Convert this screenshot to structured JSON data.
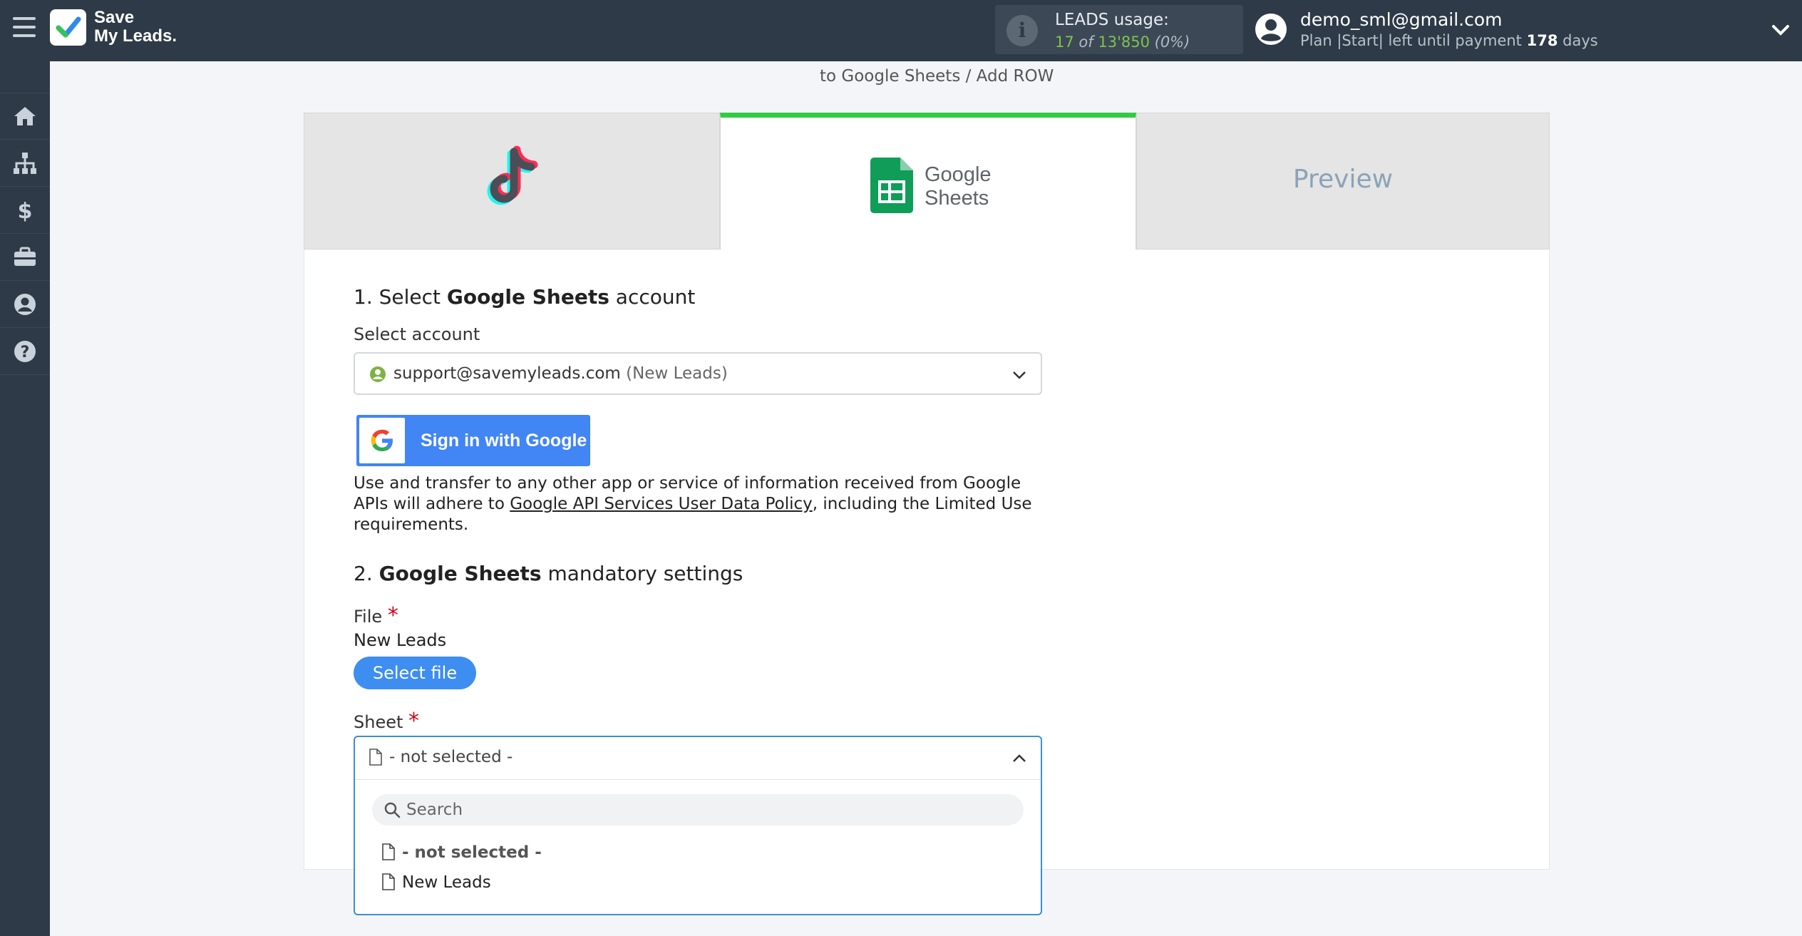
{
  "app": {
    "logo_line1": "Save",
    "logo_line2": "My Leads."
  },
  "usage": {
    "title": "LEADS usage:",
    "used": "17",
    "of": "of",
    "total": "13'850",
    "percent": "(0%)"
  },
  "user": {
    "email": "demo_sml@gmail.com",
    "plan_prefix": "Plan |Start| left until payment",
    "days": "178",
    "days_suffix": "days"
  },
  "sidebar": {
    "items": [
      {
        "name": "home-icon"
      },
      {
        "name": "sitemap-icon"
      },
      {
        "name": "dollar-icon"
      },
      {
        "name": "briefcase-icon"
      },
      {
        "name": "account-icon"
      },
      {
        "name": "help-icon"
      }
    ]
  },
  "breadcrumb": "to Google Sheets / Add ROW",
  "tabs": {
    "google_word": "Google",
    "sheets_word": "Sheets",
    "preview": "Preview"
  },
  "section1": {
    "prefix": "1. Select",
    "bold": "Google Sheets",
    "suffix": "account",
    "select_label": "Select account",
    "account_email": "support@savemyleads.com",
    "account_note": "(New Leads)",
    "google_button": "Sign in with Google",
    "policy_text_1": "Use and transfer to any other app or service of information received from Google APIs will adhere to",
    "policy_link": "Google API Services User Data Policy",
    "policy_text_2": ", including the Limited Use requirements."
  },
  "section2": {
    "prefix": "2.",
    "bold": "Google Sheets",
    "suffix": "mandatory settings",
    "file_label": "File",
    "file_value": "New Leads",
    "select_file_button": "Select file",
    "sheet_label": "Sheet",
    "sheet_selected": "- not selected -",
    "search_placeholder": "Search",
    "options": [
      "- not selected -",
      "New Leads"
    ]
  },
  "colors": {
    "topbar": "#2e3a47",
    "active_tab_accent": "#2ecc40",
    "primary_button": "#3d8ef0",
    "google_blue": "#4285f4",
    "required": "#d0021b"
  }
}
